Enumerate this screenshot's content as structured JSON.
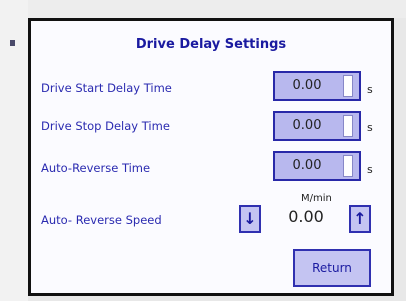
{
  "title": "Drive Delay Settings",
  "rows": [
    {
      "label": "Drive Start Delay Time",
      "value": "0.00",
      "unit": "s"
    },
    {
      "label": "Drive Stop Delay Time",
      "value": "0.00",
      "unit": "s"
    },
    {
      "label": "Auto-Reverse Time",
      "value": "0.00",
      "unit": "s"
    }
  ],
  "speed": {
    "label": "Auto- Reverse Speed",
    "unit": "M/min",
    "value": "0.00",
    "down_icon": "down-arrow-icon",
    "up_icon": "up-arrow-icon",
    "down_glyph": "↓",
    "up_glyph": "↑"
  },
  "return_label": "Return",
  "colors": {
    "text_blue": "#2a2ab0",
    "field_fill": "#b8b8ee",
    "field_border": "#2828a8",
    "screen_bg": "#fbfbff"
  }
}
